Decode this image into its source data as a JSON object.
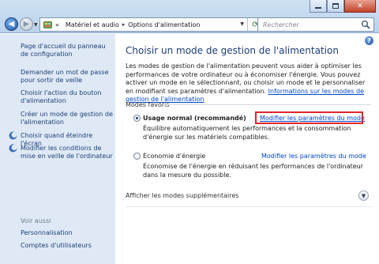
{
  "window": {
    "minimize_label": "",
    "maximize_label": "",
    "close_label": "✕"
  },
  "address": {
    "separator": "«",
    "crumbs": [
      "Matériel et audio",
      "Options d'alimentation"
    ],
    "crumb_sep": "▸"
  },
  "search": {
    "placeholder": "Rechercher"
  },
  "sidebar": {
    "items": [
      "Page d'accueil du panneau de configuration",
      "Demander un mot de passe pour sortir de veille",
      "Choisir l'action du bouton d'alimentation",
      "Créer un mode de gestion de l'alimentation",
      "Choisir quand éteindre l'écran",
      "Modifier les conditions de mise en veille de l'ordinateur"
    ],
    "see_also_header": "Voir aussi",
    "see_also": [
      "Personnalisation",
      "Comptes d'utilisateurs"
    ]
  },
  "main": {
    "title": "Choisir un mode de gestion de l'alimentation",
    "intro_text": "Les modes de gestion de l'alimentation peuvent vous aider à optimiser les performances de votre ordinateur ou à économiser l'énergie. Vous pouvez activer un mode en le sélectionnant, ou choisir un mode et le personnaliser en modifiant ses paramètres d'alimentation.",
    "intro_link": "Informations sur les modes de gestion de l'alimentation",
    "section_label": "Modes favoris",
    "plans": [
      {
        "name": "Usage normal (recommandé)",
        "selected": true,
        "description": "Équilibre automatiquement les performances et la consommation d'énergie sur les matériels compatibles.",
        "link": "Modifier les paramètres du mode"
      },
      {
        "name": "Économie d'énergie",
        "selected": false,
        "description": "Économise de l'énergie en réduisant les performances de l'ordinateur dans la mesure du possible.",
        "link": "Modifier les paramètres du mode"
      }
    ],
    "more_plans_label": "Afficher les modes supplémentaires"
  },
  "colors": {
    "link": "#0046c8",
    "title": "#1e3d7a",
    "sidebar_bg": "#dfe9f6",
    "highlight": "#e2262b"
  }
}
